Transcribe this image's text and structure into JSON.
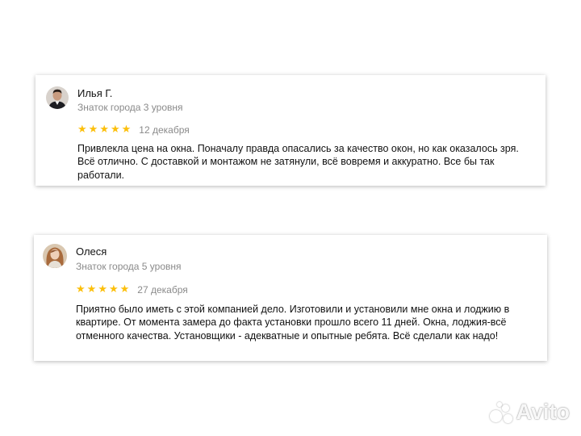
{
  "reviews": [
    {
      "name": "Илья Г.",
      "level": "Знаток города 3 уровня",
      "rating": 5,
      "date": "12 декабря",
      "text": "Привлекла цена на окна. Поначалу правда опасались за качество окон, но как оказалось зря. Всё отлично. С доставкой и монтажом не затянули, всё вовремя и аккуратно. Все бы так работали."
    },
    {
      "name": "Олеся",
      "level": "Знаток города 5 уровня",
      "rating": 5,
      "date": "27 декабря",
      "text": "Приятно было иметь с этой компанией дело. Изготовили и установили мне окна и лоджию в квартире. От момента замера до факта установки прошло всего 11 дней. Окна, лоджия-всё отменного качества. Установщики - адекватные и опытные ребята. Всё сделали как надо!"
    }
  ],
  "star_glyph": "★",
  "colors": {
    "star": "#fcbf0b",
    "muted": "#8a8a8a"
  },
  "watermark": {
    "text": "Avito",
    "logo": "avito-logo-icon"
  }
}
